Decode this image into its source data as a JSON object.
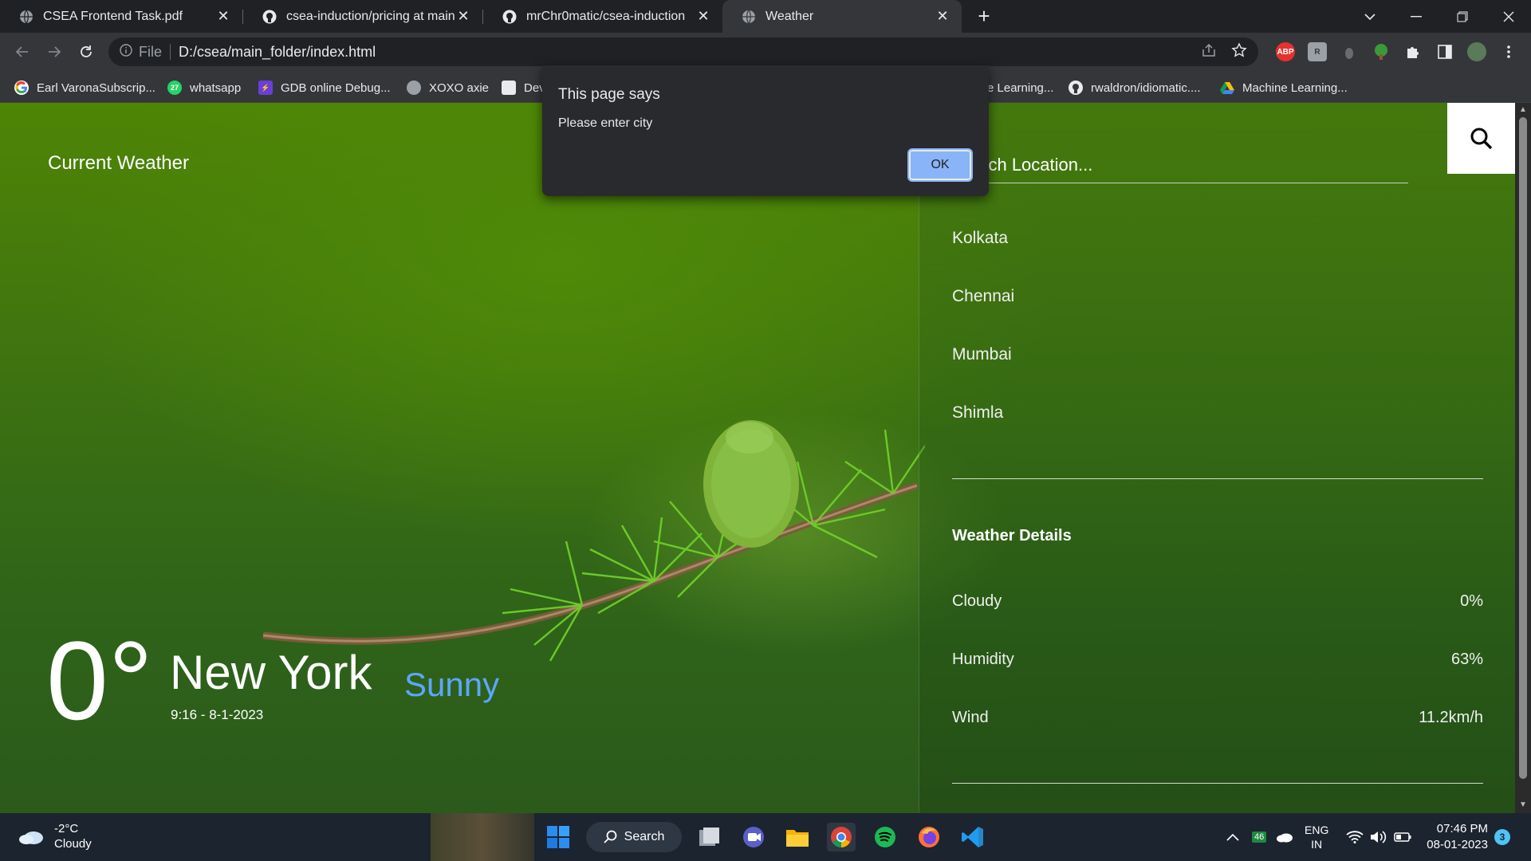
{
  "browser": {
    "tabs": [
      {
        "title": "CSEA Frontend Task.pdf",
        "favicon": "globe-icon"
      },
      {
        "title": "csea-induction/pricing at main · r",
        "favicon": "github-icon"
      },
      {
        "title": "mrChr0matic/csea-induction",
        "favicon": "github-icon"
      },
      {
        "title": "Weather",
        "favicon": "globe-icon",
        "active": true
      }
    ],
    "new_tab": "+",
    "omnibox": {
      "scheme": "File",
      "url": "D:/csea/main_folder/index.html"
    },
    "extensions": [
      {
        "name": "adblock-icon",
        "label": "ABP",
        "color": "#e5322f"
      },
      {
        "name": "extension-r-icon",
        "label": "R",
        "color": "#9aa0a6"
      },
      {
        "name": "extension-gray-icon",
        "label": "",
        "color": "#6b6b6b"
      },
      {
        "name": "tree-icon",
        "label": "",
        "color": "#3a9a3a"
      },
      {
        "name": "puzzle-icon",
        "label": "",
        "color": "#e8eaed"
      },
      {
        "name": "sidebar-icon",
        "label": "",
        "color": "#e8eaed"
      },
      {
        "name": "profile-avatar",
        "label": "",
        "color": "#5a7a5a"
      }
    ],
    "bookmarks": [
      {
        "label": "Earl VaronaSubscrip...",
        "icon": "google-icon",
        "color": "#4285f4"
      },
      {
        "label": "whatsapp",
        "icon": "whatsapp-icon",
        "color": "#25d366",
        "badge": "27"
      },
      {
        "label": "GDB online Debug...",
        "icon": "bolt-icon",
        "color": "#6a3fd8"
      },
      {
        "label": "XOXO axie",
        "icon": "globe-icon",
        "color": "#9aa0a6"
      },
      {
        "label": "Dev",
        "icon": "search-doc-icon",
        "color": "#e8eaed"
      },
      {
        "label": "e Learning...",
        "icon": "",
        "color": ""
      },
      {
        "label": "rwaldron/idiomatic....",
        "icon": "github-icon",
        "color": "#e8eaed"
      },
      {
        "label": "Machine Learning...",
        "icon": "drive-icon",
        "color": "#fbbc04"
      }
    ]
  },
  "alert": {
    "title": "This page says",
    "message": "Please enter city",
    "ok_label": "OK"
  },
  "weather_app": {
    "brand": "Current Weather",
    "temperature": "0°",
    "city": "New York",
    "datetime": "9:16 - 8-1-2023",
    "condition": "Sunny",
    "search_placeholder": "Search Location...",
    "locations": [
      "Kolkata",
      "Chennai",
      "Mumbai",
      "Shimla"
    ],
    "details_title": "Weather Details",
    "details": [
      {
        "label": "Cloudy",
        "value": "0%"
      },
      {
        "label": "Humidity",
        "value": "63%"
      },
      {
        "label": "Wind",
        "value": "11.2km/h"
      }
    ],
    "colors": {
      "condition": "#5da6ff",
      "background": "#3f7410"
    }
  },
  "taskbar": {
    "weather": {
      "temp": "-2°C",
      "condition": "Cloudy"
    },
    "search_label": "Search",
    "apps": [
      "windows-start-icon",
      "task-view-icon",
      "teams-icon",
      "file-explorer-icon",
      "chrome-icon",
      "spotify-icon",
      "firefox-icon",
      "vscode-icon"
    ],
    "tray": {
      "battery_badge": "46",
      "lang_top": "ENG",
      "lang_bottom": "IN"
    },
    "clock": {
      "time": "07:46 PM",
      "date": "08-01-2023"
    },
    "notifications": "3"
  }
}
